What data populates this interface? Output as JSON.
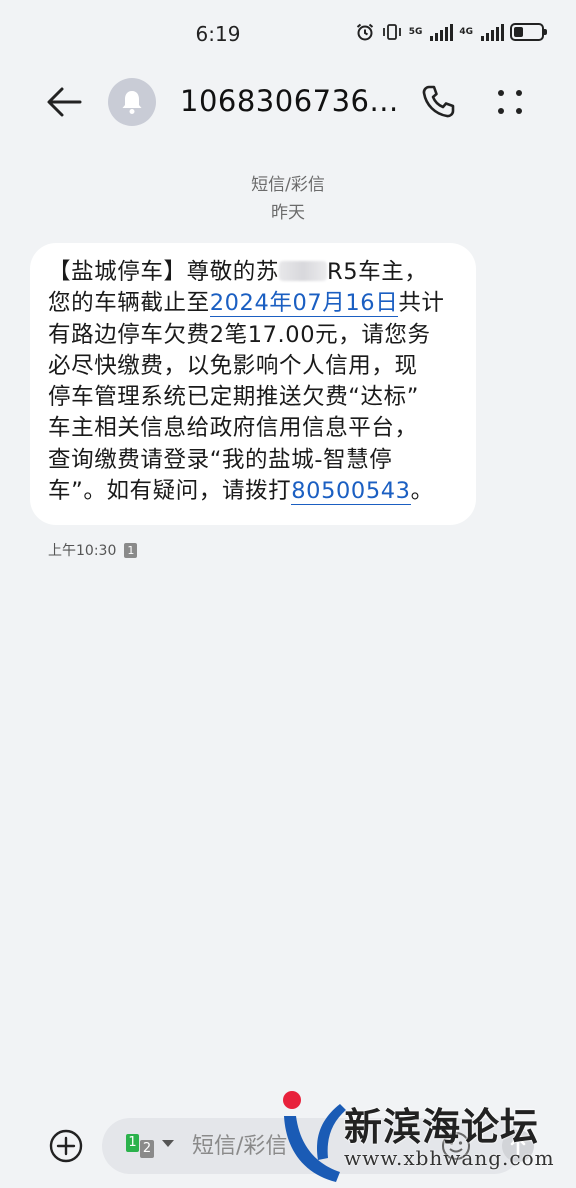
{
  "status_bar": {
    "time": "6:19",
    "network_1": "5G",
    "network_2": "4G",
    "battery_level": 0.3
  },
  "header": {
    "contact_number": "1068306736...",
    "icons": [
      "back-arrow-icon",
      "bell-avatar-icon",
      "phone-icon",
      "more-vertical-icon"
    ]
  },
  "conversation": {
    "channel_label": "短信/彩信",
    "day_label": "昨天",
    "message": {
      "line1_a": "【盐城停车】尊敬的苏",
      "line1_b": "R5车主，",
      "line2_a": "您的车辆截止至",
      "line2_link": "2024年07月16日",
      "line2_b": "共计",
      "line3": "有路边停车欠费2笔17.00元，请您务",
      "line4": "必尽快缴费，以免影响个人信用，现",
      "line5": "停车管理系统已定期推送欠费“达标”",
      "line6": "车主相关信息给政府信用信息平台，",
      "line7": "查询缴费请登录“我的盐城-智慧停",
      "line8_a": "车”。如有疑问，请拨打",
      "line8_link": "80500543",
      "line8_b": "。"
    },
    "sent_time": "上午10:30",
    "sim_slot": "1"
  },
  "composer": {
    "sim1": "1",
    "sim2": "2",
    "placeholder": "短信/彩信"
  },
  "watermark": {
    "title": "新滨海论坛",
    "url": "www.xbhwang.com"
  },
  "colors": {
    "background": "#f1f3f5",
    "bubble": "#ffffff",
    "link": "#1b5fc2",
    "sim1_green": "#2bb24c",
    "avatar_bg": "#c9ccd6",
    "watermark_red": "#e8213b",
    "watermark_blue": "#1a5bb5"
  }
}
